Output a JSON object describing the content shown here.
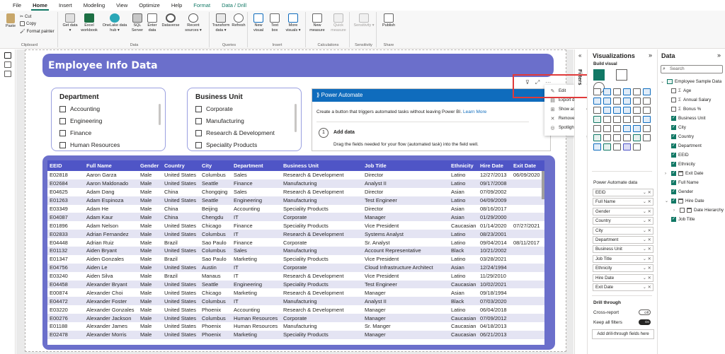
{
  "menu": {
    "items": [
      "File",
      "Home",
      "Insert",
      "Modeling",
      "View",
      "Optimize",
      "Help",
      "Format",
      "Data / Drill"
    ]
  },
  "ribbon": {
    "clipboard": {
      "paste": "Paste",
      "cut": "Cut",
      "copy": "Copy",
      "format_painter": "Format painter",
      "group": "Clipboard"
    },
    "data": {
      "get_data": "Get data ▾",
      "excel": "Excel workbook",
      "onelake": "OneLake data hub ▾",
      "sql": "SQL Server",
      "enter": "Enter data",
      "dataverse": "Dataverse",
      "recent": "Recent sources ▾",
      "group": "Data"
    },
    "queries": {
      "transform": "Transform data ▾",
      "refresh": "Refresh",
      "group": "Queries"
    },
    "insert": {
      "new_visual": "New visual",
      "text_box": "Text box",
      "more_visuals": "More visuals ▾",
      "group": "Insert"
    },
    "calculations": {
      "new_measure": "New measure",
      "quick_measure": "Quick measure",
      "group": "Calculations"
    },
    "sensitivity": {
      "label": "Sensitivity ▾",
      "group": "Sensitivity"
    },
    "share": {
      "publish": "Publish",
      "group": "Share"
    }
  },
  "report": {
    "title": "Employee Info Data",
    "slicers": [
      {
        "title": "Department",
        "options": [
          "Accounting",
          "Engineering",
          "Finance",
          "Human Resources"
        ]
      },
      {
        "title": "Business Unit",
        "options": [
          "Corporate",
          "Manufacturing",
          "Research & Development",
          "Speciality Products"
        ]
      }
    ],
    "power_automate": {
      "header": "Power Automate",
      "desc": "Create a button that triggers automated tasks without leaving Power BI.",
      "learn_more": "Learn More",
      "step": "1",
      "add_data": "Add data",
      "drag_text": "Drag the fields needed for your flow (automated task) into the field well."
    },
    "visual_header": {
      "filter_icon": "⊽",
      "focus_icon": "⤢",
      "more_icon": "···"
    },
    "context_menu": [
      {
        "icon": "✎",
        "label": "Edit"
      },
      {
        "icon": "▤",
        "label": "Export data"
      },
      {
        "icon": "⊞",
        "label": "Show as a table"
      },
      {
        "icon": "✕",
        "label": "Remove"
      },
      {
        "icon": "◎",
        "label": "Spotlight"
      }
    ],
    "table": {
      "columns": [
        "EEID",
        "Full Name",
        "Gender",
        "Country",
        "City",
        "Department",
        "Business Unit",
        "Job Title",
        "Ethnicity",
        "Hire Date",
        "Exit Date"
      ],
      "rows": [
        [
          "E02818",
          "Aaron Garza",
          "Male",
          "United States",
          "Columbus",
          "Sales",
          "Research & Development",
          "Director",
          "Latino",
          "12/27/2013",
          "06/09/2020"
        ],
        [
          "E02684",
          "Aaron Maldonado",
          "Male",
          "United States",
          "Seattle",
          "Finance",
          "Manufacturing",
          "Analyst II",
          "Latino",
          "09/17/2008",
          ""
        ],
        [
          "E04625",
          "Adam Dang",
          "Male",
          "China",
          "Chongqing",
          "Sales",
          "Research & Development",
          "Director",
          "Asian",
          "07/09/2002",
          ""
        ],
        [
          "E01263",
          "Adam Espinoza",
          "Male",
          "United States",
          "Seattle",
          "Engineering",
          "Manufacturing",
          "Test Engineer",
          "Latino",
          "04/09/2009",
          ""
        ],
        [
          "E03349",
          "Adam He",
          "Male",
          "China",
          "Beijing",
          "Accounting",
          "Speciality Products",
          "Director",
          "Asian",
          "08/16/2017",
          ""
        ],
        [
          "E04087",
          "Adam Kaur",
          "Male",
          "China",
          "Chengdu",
          "IT",
          "Corporate",
          "Manager",
          "Asian",
          "01/29/2000",
          ""
        ],
        [
          "E01896",
          "Adam Nelson",
          "Male",
          "United States",
          "Chicago",
          "Finance",
          "Speciality Products",
          "Vice President",
          "Caucasian",
          "01/14/2020",
          "07/27/2021"
        ],
        [
          "E02833",
          "Adrian Fernandez",
          "Male",
          "United States",
          "Columbus",
          "IT",
          "Research & Development",
          "Systems Analyst",
          "Latino",
          "08/23/2001",
          ""
        ],
        [
          "E04448",
          "Adrian Ruiz",
          "Male",
          "Brazil",
          "Sao Paulo",
          "Finance",
          "Corporate",
          "Sr. Analyst",
          "Latino",
          "09/04/2014",
          "08/11/2017"
        ],
        [
          "E01132",
          "Aiden Bryant",
          "Male",
          "United States",
          "Columbus",
          "Sales",
          "Manufacturing",
          "Account Representative",
          "Black",
          "10/21/2002",
          ""
        ],
        [
          "E01347",
          "Aiden Gonzales",
          "Male",
          "Brazil",
          "Sao Paulo",
          "Marketing",
          "Speciality Products",
          "Vice President",
          "Latino",
          "03/28/2021",
          ""
        ],
        [
          "E04756",
          "Aiden Le",
          "Male",
          "United States",
          "Austin",
          "IT",
          "Corporate",
          "Cloud Infrastructure Architect",
          "Asian",
          "12/24/1994",
          ""
        ],
        [
          "E03240",
          "Aiden Silva",
          "Male",
          "Brazil",
          "Manaus",
          "IT",
          "Research & Development",
          "Vice President",
          "Latino",
          "11/29/2010",
          ""
        ],
        [
          "E04458",
          "Alexander Bryant",
          "Male",
          "United States",
          "Seattle",
          "Engineering",
          "Speciality Products",
          "Test Engineer",
          "Caucasian",
          "10/02/2021",
          ""
        ],
        [
          "E00874",
          "Alexander Choi",
          "Male",
          "United States",
          "Chicago",
          "Marketing",
          "Research & Development",
          "Manager",
          "Asian",
          "09/18/1994",
          ""
        ],
        [
          "E04472",
          "Alexander Foster",
          "Male",
          "United States",
          "Columbus",
          "IT",
          "Manufacturing",
          "Analyst II",
          "Black",
          "07/03/2020",
          ""
        ],
        [
          "E03220",
          "Alexander Gonzales",
          "Male",
          "United States",
          "Phoenix",
          "Accounting",
          "Research & Development",
          "Manager",
          "Latino",
          "06/04/2018",
          ""
        ],
        [
          "E00276",
          "Alexander Jackson",
          "Male",
          "United States",
          "Columbus",
          "Human Resources",
          "Corporate",
          "Manager",
          "Caucasian",
          "07/09/2012",
          ""
        ],
        [
          "E01188",
          "Alexander James",
          "Male",
          "United States",
          "Phoenix",
          "Human Resources",
          "Manufacturing",
          "Sr. Manger",
          "Caucasian",
          "04/18/2013",
          ""
        ],
        [
          "E02478",
          "Alexander Morris",
          "Male",
          "United States",
          "Phoenix",
          "Marketing",
          "Speciality Products",
          "Manager",
          "Caucasian",
          "06/21/2013",
          ""
        ]
      ]
    }
  },
  "filters_pane": {
    "label": "Filters",
    "chevron": "«"
  },
  "viz_pane": {
    "title": "Visualizations",
    "expand": "»",
    "build_visual": "Build visual",
    "section": "Power Automate data",
    "wells": [
      "EEID",
      "Full Name",
      "Gender",
      "Country",
      "City",
      "Department",
      "Business Unit",
      "Job Title",
      "Ethnicity",
      "Hire Date",
      "Exit Date"
    ],
    "drill_through": "Drill through",
    "cross_report": "Cross-report",
    "cross_report_state": "Off",
    "keep_all_filters": "Keep all filters",
    "keep_all_state": "On",
    "add_fields": "Add drill-through fields here"
  },
  "data_pane": {
    "title": "Data",
    "expand": "»",
    "search_placeholder": "Search",
    "table_name": "Employee Sample Data",
    "fields": [
      {
        "label": "Age",
        "checked": false,
        "sigma": true
      },
      {
        "label": "Annual Salary",
        "checked": false,
        "sigma": true
      },
      {
        "label": "Bonus %",
        "checked": false,
        "sigma": true
      },
      {
        "label": "Business Unit",
        "checked": true
      },
      {
        "label": "City",
        "checked": true
      },
      {
        "label": "Country",
        "checked": true
      },
      {
        "label": "Department",
        "checked": true
      },
      {
        "label": "EEID",
        "checked": true
      },
      {
        "label": "Ethnicity",
        "checked": true
      },
      {
        "label": "Exit Date",
        "checked": true,
        "date": true
      },
      {
        "label": "Full Name",
        "checked": true
      },
      {
        "label": "Gender",
        "checked": true
      },
      {
        "label": "Hire Date",
        "checked": true,
        "date": true,
        "expanded": true
      },
      {
        "label": "Date Hierarchy",
        "checked": false,
        "sub": true
      },
      {
        "label": "Job Title",
        "checked": true
      }
    ]
  },
  "colors": {
    "accent": "#117865",
    "title_bg": "#6b6fcb",
    "table_header": "#4f55c6",
    "row_alt": "#e4e4f3",
    "pa_blue": "#0f6cbd",
    "highlight_red": "#e03a3a"
  }
}
